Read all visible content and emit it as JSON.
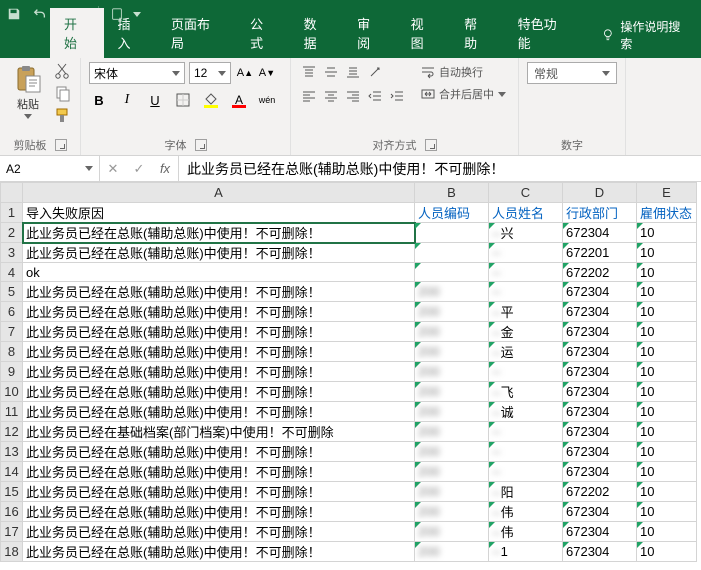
{
  "titlebar": {
    "save_icon": "save",
    "undo_icon": "undo",
    "redo_icon": "redo"
  },
  "tabs": {
    "home": "开始",
    "insert": "插入",
    "layout": "页面布局",
    "formula": "公式",
    "data": "数据",
    "review": "审阅",
    "view": "视图",
    "help": "帮助",
    "feature": "特色功能",
    "tell_me": "操作说明搜索"
  },
  "ribbon": {
    "clipboard": {
      "paste": "粘贴",
      "label": "剪贴板"
    },
    "font": {
      "name": "宋体",
      "size": "12",
      "grow": "A",
      "shrink": "A",
      "label": "字体"
    },
    "align": {
      "wrap": "自动换行",
      "merge": "合并后居中",
      "label": "对齐方式"
    },
    "number": {
      "format": "常规",
      "label": "数字"
    }
  },
  "namebox": "A2",
  "formula": "此业务员已经在总账(辅助总账)中使用！不可删除！",
  "columns": [
    "A",
    "B",
    "C",
    "D",
    "E"
  ],
  "chart_data": {
    "type": "table",
    "headers": {
      "A": "导入失败原因",
      "B": "人员编码",
      "C": "人员姓名",
      "D": "行政部门",
      "E": "雇佣状态"
    },
    "rows": [
      {
        "r": 2,
        "A": "此业务员已经在总账(辅助总账)中使用！不可删除！",
        "B": "",
        "C": "兴",
        "D": "672304",
        "E": "10"
      },
      {
        "r": 3,
        "A": "此业务员已经在总账(辅助总账)中使用！不可删除！",
        "B": "",
        "C": "",
        "D": "672201",
        "E": "10"
      },
      {
        "r": 4,
        "A": "ok",
        "B": "",
        "C": "",
        "D": "672202",
        "E": "10"
      },
      {
        "r": 5,
        "A": "此业务员已经在总账(辅助总账)中使用！不可删除！",
        "B": "200",
        "C": "",
        "D": "672304",
        "E": "10"
      },
      {
        "r": 6,
        "A": "此业务员已经在总账(辅助总账)中使用！不可删除！",
        "B": "200",
        "C": "平",
        "D": "672304",
        "E": "10"
      },
      {
        "r": 7,
        "A": "此业务员已经在总账(辅助总账)中使用！不可删除！",
        "B": "200",
        "C": "金",
        "D": "672304",
        "E": "10"
      },
      {
        "r": 8,
        "A": "此业务员已经在总账(辅助总账)中使用！不可删除！",
        "B": "200",
        "C": "运",
        "D": "672304",
        "E": "10"
      },
      {
        "r": 9,
        "A": "此业务员已经在总账(辅助总账)中使用！不可删除！",
        "B": "200",
        "C": "",
        "D": "672304",
        "E": "10"
      },
      {
        "r": 10,
        "A": "此业务员已经在总账(辅助总账)中使用！不可删除！",
        "B": "200",
        "C": "飞",
        "D": "672304",
        "E": "10"
      },
      {
        "r": 11,
        "A": "此业务员已经在总账(辅助总账)中使用！不可删除！",
        "B": "200",
        "C": "诚",
        "D": "672304",
        "E": "10"
      },
      {
        "r": 12,
        "A": "此业务员已经在基础档案(部门档案)中使用！不可删除",
        "B": "200",
        "C": "",
        "D": "672304",
        "E": "10"
      },
      {
        "r": 13,
        "A": "此业务员已经在总账(辅助总账)中使用！不可删除！",
        "B": "200",
        "C": "",
        "D": "672304",
        "E": "10"
      },
      {
        "r": 14,
        "A": "此业务员已经在总账(辅助总账)中使用！不可删除！",
        "B": "200",
        "C": "",
        "D": "672304",
        "E": "10"
      },
      {
        "r": 15,
        "A": "此业务员已经在总账(辅助总账)中使用！不可删除！",
        "B": "200",
        "C": "阳",
        "D": "672202",
        "E": "10"
      },
      {
        "r": 16,
        "A": "此业务员已经在总账(辅助总账)中使用！不可删除！",
        "B": "200",
        "C": "伟",
        "D": "672304",
        "E": "10"
      },
      {
        "r": 17,
        "A": "此业务员已经在总账(辅助总账)中使用！不可删除！",
        "B": "200",
        "C": "伟",
        "D": "672304",
        "E": "10"
      },
      {
        "r": 18,
        "A": "此业务员已经在总账(辅助总账)中使用！不可删除！",
        "B": "200",
        "C": "1",
        "D": "672304",
        "E": "10"
      }
    ]
  }
}
